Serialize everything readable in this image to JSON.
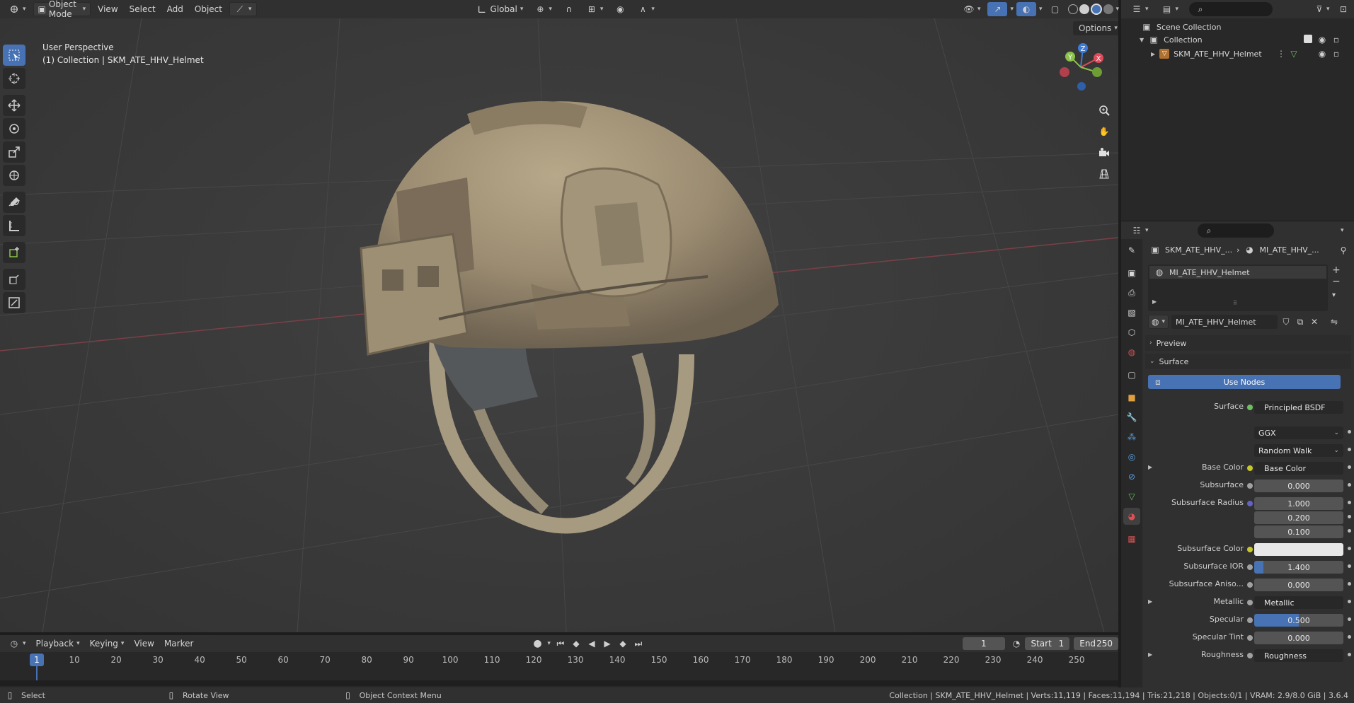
{
  "viewport_header": {
    "mode": "Object Mode",
    "menus": [
      "View",
      "Select",
      "Add",
      "Object"
    ],
    "orientation": "Global"
  },
  "viewport": {
    "perspective": "User Perspective",
    "collection_line": "(1) Collection | SKM_ATE_HHV_Helmet",
    "options_label": "Options"
  },
  "toolbar": {
    "tools": [
      "select-box",
      "cursor",
      "move",
      "rotate",
      "scale",
      "transform",
      "annotate",
      "measure",
      "add-cube",
      "extrude",
      "inset"
    ]
  },
  "outliner": {
    "scene_collection": "Scene Collection",
    "collection": "Collection",
    "object": "SKM_ATE_HHV_Helmet"
  },
  "properties": {
    "breadcrumb_object": "SKM_ATE_HHV_...",
    "breadcrumb_material": "MI_ATE_HHV_...",
    "material_slot": "MI_ATE_HHV_Helmet",
    "material_name": "MI_ATE_HHV_Helmet",
    "preview_label": "Preview",
    "surface_label": "Surface",
    "use_nodes": "Use Nodes",
    "surface_shader_label": "Surface",
    "surface_shader": "Principled BSDF",
    "distribution": "GGX",
    "subsurface_method": "Random Walk",
    "rows": [
      {
        "label": "Base Color",
        "value": "Base Color",
        "kind": "link",
        "dot": "#c7c729",
        "tri": true
      },
      {
        "label": "Subsurface",
        "value": "0.000",
        "kind": "num",
        "dot": "#a1a1a1"
      },
      {
        "label": "Subsurface Radius",
        "value": "1.000",
        "kind": "num",
        "dot": "#6363c7"
      },
      {
        "label": "",
        "value": "0.200",
        "kind": "num"
      },
      {
        "label": "",
        "value": "0.100",
        "kind": "num"
      },
      {
        "label": "Subsurface Color",
        "value": "",
        "kind": "color",
        "dot": "#c7c729"
      },
      {
        "label": "Subsurface IOR",
        "value": "1.400",
        "kind": "bar",
        "dot": "#a1a1a1",
        "fill": 0.1
      },
      {
        "label": "Subsurface Aniso...",
        "value": "0.000",
        "kind": "num",
        "dot": "#a1a1a1"
      },
      {
        "label": "Metallic",
        "value": "Metallic",
        "kind": "link",
        "dot": "#a1a1a1",
        "tri": true
      },
      {
        "label": "Specular",
        "value": "0.500",
        "kind": "bar",
        "dot": "#a1a1a1",
        "fill": 0.5
      },
      {
        "label": "Specular Tint",
        "value": "0.000",
        "kind": "num",
        "dot": "#a1a1a1"
      },
      {
        "label": "Roughness",
        "value": "Roughness",
        "kind": "link",
        "dot": "#a1a1a1",
        "tri": true
      }
    ]
  },
  "timeline": {
    "menus": [
      "Playback",
      "Keying",
      "View",
      "Marker"
    ],
    "current_frame": "1",
    "start_label": "Start",
    "start": "1",
    "end_label": "End",
    "end": "250",
    "frame_labels": [
      "1",
      "10",
      "20",
      "30",
      "40",
      "50",
      "60",
      "70",
      "80",
      "90",
      "100",
      "110",
      "120",
      "130",
      "140",
      "150",
      "160",
      "170",
      "180",
      "190",
      "200",
      "210",
      "220",
      "230",
      "240",
      "250"
    ]
  },
  "statusbar": {
    "select": "Select",
    "rotate": "Rotate View",
    "context": "Object Context Menu",
    "stats": "Collection | SKM_ATE_HHV_Helmet | Verts:11,119 | Faces:11,194 | Tris:21,218 | Objects:0/1 | VRAM: 2.9/8.0 GiB | 3.6.4"
  },
  "colors": {
    "accent": "#4772b3",
    "axis_x": "#e04a5a",
    "axis_y": "#8bc34a",
    "axis_z": "#3d7bd9"
  }
}
